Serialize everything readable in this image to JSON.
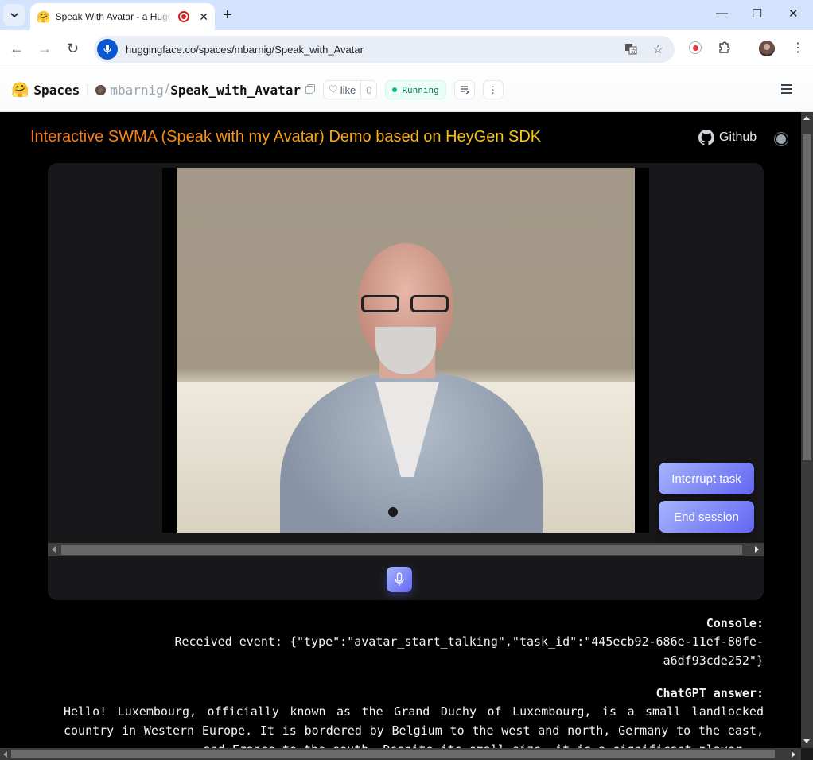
{
  "browser": {
    "tab": {
      "favicon": "🤗",
      "title": "Speak With Avatar - a Hugging Face Space",
      "recording_indicator": "recording-icon",
      "close_label": "✕"
    },
    "new_tab_label": "+",
    "window_controls": {
      "minimize": "—",
      "maximize": "☐",
      "close": "✕"
    },
    "url": "huggingface.co/spaces/mbarnig/Speak_with_Avatar",
    "nav": {
      "back": "←",
      "forward": "→",
      "reload": "↻"
    },
    "icons": [
      "translate-icon",
      "bookmark-star-icon",
      "screen-record-icon",
      "extensions-icon",
      "profile-avatar",
      "menu-kebab-icon"
    ]
  },
  "hf_header": {
    "logo": "🤗",
    "spaces_label": "Spaces",
    "owner": "mbarnig",
    "space_name": "Speak_with_Avatar",
    "like_label": "like",
    "like_count": "0",
    "status": "Running"
  },
  "app": {
    "title": "Interactive SWMA (Speak with my Avatar) Demo based on HeyGen SDK",
    "github_label": "Github",
    "buttons": {
      "interrupt": "Interrupt task",
      "end_session": "End session"
    },
    "console_label": "Console:",
    "console_text": "Received event: {\"type\":\"avatar_start_talking\",\"task_id\":\"445ecb92-686e-11ef-80fe-a6df93cde252\"}",
    "answer_label": "ChatGPT answer:",
    "answer_text": "Hello! Luxembourg, officially known as the Grand Duchy of Luxembourg, is a small landlocked country in Western Europe. It is bordered by Belgium to the west and north, Germany to the east, and France to the south. Despite its small size, it is a significant player..."
  }
}
